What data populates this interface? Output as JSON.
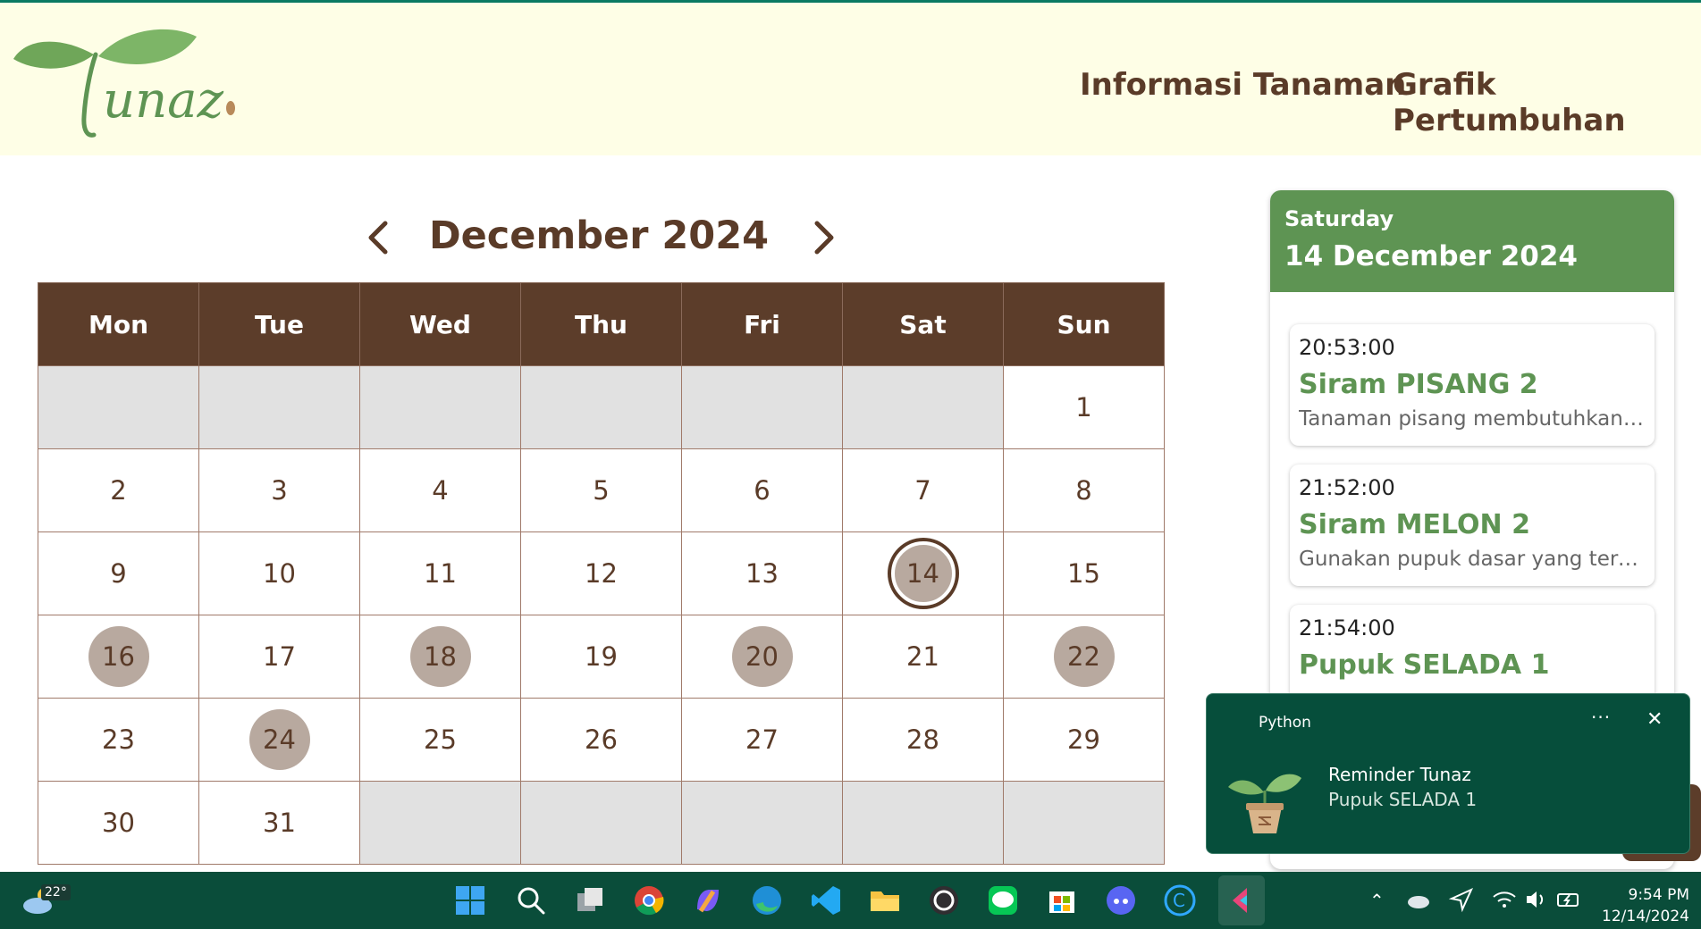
{
  "header": {
    "logo_text": "Tunaz",
    "nav": [
      "Informasi Tanaman",
      "Grafik Pertumbuhan"
    ]
  },
  "calendar": {
    "title": "December 2024",
    "weekdays": [
      "Mon",
      "Tue",
      "Wed",
      "Thu",
      "Fri",
      "Sat",
      "Sun"
    ],
    "weeks": [
      [
        "",
        "",
        "",
        "",
        "",
        "",
        "1"
      ],
      [
        "2",
        "3",
        "4",
        "5",
        "6",
        "7",
        "8"
      ],
      [
        "9",
        "10",
        "11",
        "12",
        "13",
        "14",
        "15"
      ],
      [
        "16",
        "17",
        "18",
        "19",
        "20",
        "21",
        "22"
      ],
      [
        "23",
        "24",
        "25",
        "26",
        "27",
        "28",
        "29"
      ],
      [
        "30",
        "31",
        "",
        "",
        "",
        "",
        ""
      ]
    ],
    "selected_day": "14",
    "marked_days": [
      "14",
      "16",
      "18",
      "20",
      "22",
      "24"
    ]
  },
  "panel": {
    "weekday": "Saturday",
    "date": "14 December 2024",
    "events": [
      {
        "time": "20:53:00",
        "title": "Siram PISANG 2",
        "desc": "Tanaman pisang membutuhkan ai..."
      },
      {
        "time": "21:52:00",
        "title": "Siram MELON 2",
        "desc": "Gunakan pupuk dasar yang terdiri..."
      },
      {
        "time": "21:54:00",
        "title": "Pupuk SELADA 1",
        "desc": ""
      }
    ]
  },
  "toast": {
    "app": "Python",
    "title": "Reminder Tunaz",
    "body": "Pupuk SELADA 1",
    "more": "···",
    "close": "✕"
  },
  "taskbar": {
    "weather_temp": "22°",
    "icons": [
      "windows-start-icon",
      "search-icon",
      "task-view-icon",
      "chrome-icon",
      "copilot-icon",
      "edge-icon",
      "vscode-icon",
      "file-explorer-icon",
      "obs-icon",
      "line-icon",
      "microsoft-store-icon",
      "discord-icon",
      "ccleaner-icon",
      "flutter-app-icon"
    ],
    "time": "9:54 PM",
    "date": "12/14/2024"
  },
  "colors": {
    "brown": "#5c3d2a",
    "green": "#5e9453",
    "marked": "#b8a99f",
    "taskbar": "#0a4d3a",
    "header_bg": "#fefee6"
  }
}
